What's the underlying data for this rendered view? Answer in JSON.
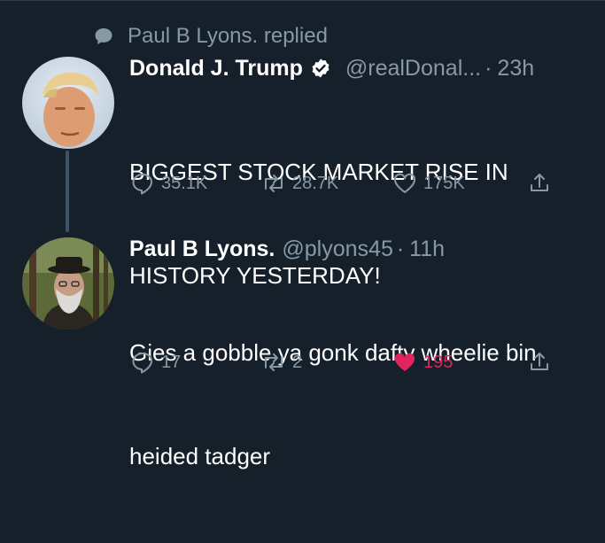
{
  "context": {
    "text": "Paul B Lyons. replied",
    "icon": "speech-bubble-icon"
  },
  "tweets": [
    {
      "name": "Donald J. Trump",
      "verified": true,
      "handle": "@realDonal...",
      "dot": "·",
      "time": "23h",
      "text_lines": [
        "BIGGEST STOCK MARKET RISE IN",
        "HISTORY YESTERDAY!"
      ],
      "replies": "35.1K",
      "retweets": "28.7K",
      "likes": "175K",
      "liked": false
    },
    {
      "name": "Paul B Lyons.",
      "verified": false,
      "handle": "@plyons45",
      "dot": "·",
      "time": "11h",
      "text_lines": [
        "Gies a gobble ya gonk dafty wheelie bin",
        "heided tadger"
      ],
      "replies": "17",
      "retweets": "2",
      "likes": "195",
      "liked": true
    }
  ],
  "colors": {
    "background": "#15202b",
    "secondary_text": "#8899a6",
    "like_pink": "#e0245e",
    "thread_line": "#3d5466"
  }
}
